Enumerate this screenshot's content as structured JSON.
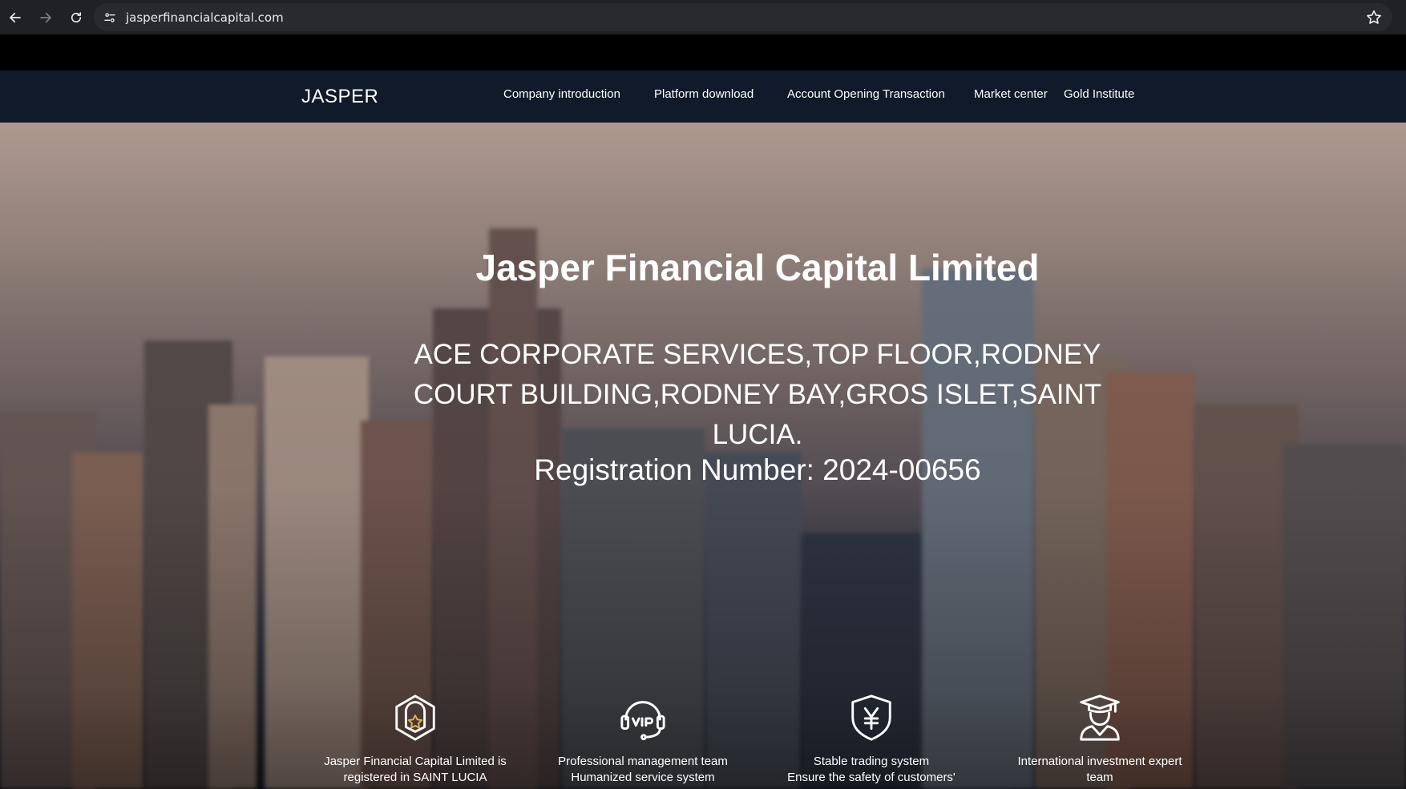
{
  "browser": {
    "url": "jasperfinancialcapital.com",
    "icons": [
      "back-arrow-icon",
      "forward-arrow-icon",
      "reload-icon",
      "site-info-icon",
      "bookmark-star-icon"
    ]
  },
  "header": {
    "logo": "JASPER",
    "nav": [
      {
        "label": "Company introduction"
      },
      {
        "label": "Platform download"
      },
      {
        "label": "Account Opening Transaction"
      },
      {
        "label": "Market center"
      },
      {
        "label": "Gold Institute"
      }
    ]
  },
  "hero": {
    "title": "Jasper Financial Capital Limited",
    "address": "ACE CORPORATE SERVICES,TOP FLOOR,RODNEY COURT BUILDING,RODNEY BAY,GROS ISLET,SAINT LUCIA.",
    "registration": "Registration Number: 2024-00656"
  },
  "features": [
    {
      "icon": "badge-star-icon",
      "line1": "Jasper Financial Capital Limited is",
      "line2": "registered in SAINT LUCIA"
    },
    {
      "icon": "vip-headset-icon",
      "line1": "Professional management team",
      "line2": "Humanized service system"
    },
    {
      "icon": "shield-yen-icon",
      "line1": "Stable trading system",
      "line2": "Ensure the safety of customers'"
    },
    {
      "icon": "graduate-icon",
      "line1": "International investment expert",
      "line2": "team"
    }
  ]
}
